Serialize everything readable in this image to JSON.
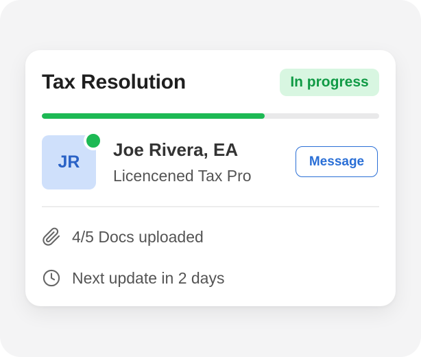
{
  "card": {
    "title": "Tax Resolution",
    "status": "In progress",
    "progress": 0.66
  },
  "professional": {
    "initials": "JR",
    "name": "Joe Rivera, EA",
    "role": "Licencened Tax Pro",
    "online": true,
    "message_label": "Message"
  },
  "details": {
    "docs_text": "4/5 Docs uploaded",
    "docs_icon": "paperclip-icon",
    "update_text": "Next update in 2 days",
    "update_icon": "clock-icon"
  },
  "colors": {
    "accent_green": "#1db954",
    "badge_bg": "#d8f6e1",
    "badge_text": "#109a45",
    "link_blue": "#2a6fd6",
    "avatar_bg": "#cfe0fb"
  }
}
